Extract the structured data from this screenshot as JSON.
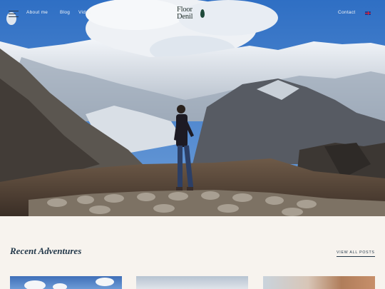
{
  "header": {
    "logo_line1": "Floor",
    "logo_line2": "Denil",
    "nav_left": [
      "About me",
      "Blog",
      "Video"
    ],
    "nav_right": "Contact",
    "language_flag": "uk-flag"
  },
  "recent": {
    "title": "Recent Adventures",
    "view_all": "VIEW ALL POSTS"
  },
  "colors": {
    "background": "#f7f3ee",
    "heading": "#23384a",
    "sky": "#3a79c8"
  }
}
